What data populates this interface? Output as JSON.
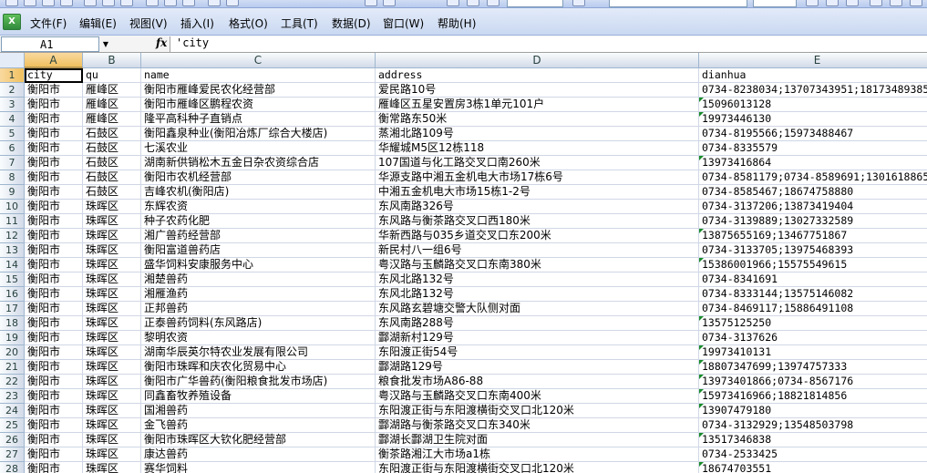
{
  "menubar": {
    "items": [
      "文件(F)",
      "编辑(E)",
      "视图(V)",
      "插入(I)",
      "格式(O)",
      "工具(T)",
      "数据(D)",
      "窗口(W)",
      "帮助(H)"
    ]
  },
  "formula_bar": {
    "name_box": "A1",
    "fx": "fx",
    "content": "'city"
  },
  "sheet": {
    "columns": [
      "A",
      "B",
      "C",
      "D",
      "E"
    ],
    "rows": [
      {
        "n": "1",
        "cells": [
          "city",
          "qu",
          "name",
          "address",
          "dianhua"
        ]
      },
      {
        "n": "2",
        "cells": [
          "衡阳市",
          "雁峰区",
          "衡阳市雁峰爱民农化经营部",
          "爱民路10号",
          "0734-8238034;13707343951;18173489385"
        ]
      },
      {
        "n": "3",
        "cells": [
          "衡阳市",
          "雁峰区",
          "衡阳市雁峰区鹏程农资",
          "雁峰区五星安置房3栋1单元101户",
          "15096013128"
        ]
      },
      {
        "n": "4",
        "cells": [
          "衡阳市",
          "雁峰区",
          "隆平高科种子直销点",
          "衡常路东50米",
          "19973446130"
        ]
      },
      {
        "n": "5",
        "cells": [
          "衡阳市",
          "石鼓区",
          "衡阳鑫泉种业(衡阳冶炼厂综合大楼店)",
          "蒸湘北路109号",
          "0734-8195566;15973488467"
        ]
      },
      {
        "n": "6",
        "cells": [
          "衡阳市",
          "石鼓区",
          "七溪农业",
          "华耀城M5区12栋118",
          "0734-8335579"
        ]
      },
      {
        "n": "7",
        "cells": [
          "衡阳市",
          "石鼓区",
          "湖南新供销松木五金日杂农资综合店",
          "107国道与化工路交叉口南260米",
          "13973416864"
        ]
      },
      {
        "n": "8",
        "cells": [
          "衡阳市",
          "石鼓区",
          "衡阳市农机经营部",
          "华源支路中湘五金机电大市场17栋6号",
          "0734-8581179;0734-8589691;13016188656"
        ]
      },
      {
        "n": "9",
        "cells": [
          "衡阳市",
          "石鼓区",
          "吉峰农机(衡阳店)",
          "中湘五金机电大市场15栋1-2号",
          "0734-8585467;18674758880"
        ]
      },
      {
        "n": "10",
        "cells": [
          "衡阳市",
          "珠晖区",
          "东辉农资",
          "东风南路326号",
          "0734-3137206;13873419404"
        ]
      },
      {
        "n": "11",
        "cells": [
          "衡阳市",
          "珠晖区",
          "种子农药化肥",
          "东风路与衡茶路交叉口西180米",
          "0734-3139889;13027332589"
        ]
      },
      {
        "n": "12",
        "cells": [
          "衡阳市",
          "珠晖区",
          "湘广兽药经营部",
          "华新西路与035乡道交叉口东200米",
          "13875655169;13467751867"
        ]
      },
      {
        "n": "13",
        "cells": [
          "衡阳市",
          "珠晖区",
          "衡阳富道兽药店",
          "新民村八一组6号",
          "0734-3133705;13975468393"
        ]
      },
      {
        "n": "14",
        "cells": [
          "衡阳市",
          "珠晖区",
          "盛华饲料安康服务中心",
          "粤汉路与玉麟路交叉口东南380米",
          "15386001966;15575549615"
        ]
      },
      {
        "n": "15",
        "cells": [
          "衡阳市",
          "珠晖区",
          "湘楚兽药",
          "东风北路132号",
          "0734-8341691"
        ]
      },
      {
        "n": "16",
        "cells": [
          "衡阳市",
          "珠晖区",
          "湘雁渔药",
          "东风北路132号",
          "0734-8333144;13575146082"
        ]
      },
      {
        "n": "17",
        "cells": [
          "衡阳市",
          "珠晖区",
          "正邦兽药",
          "东风路玄碧塘交警大队侧对面",
          "0734-8469117;15886491108"
        ]
      },
      {
        "n": "18",
        "cells": [
          "衡阳市",
          "珠晖区",
          "正泰兽药饲料(东风路店)",
          "东风南路288号",
          "13575125250"
        ]
      },
      {
        "n": "19",
        "cells": [
          "衡阳市",
          "珠晖区",
          "黎明农资",
          "酃湖新村129号",
          "0734-3137626"
        ]
      },
      {
        "n": "20",
        "cells": [
          "衡阳市",
          "珠晖区",
          "湖南华辰英尔特农业发展有限公司",
          "东阳渡正街54号",
          "19973410131"
        ]
      },
      {
        "n": "21",
        "cells": [
          "衡阳市",
          "珠晖区",
          "衡阳市珠晖和庆农化贸易中心",
          "酃湖路129号",
          "18807347699;13974757333"
        ]
      },
      {
        "n": "22",
        "cells": [
          "衡阳市",
          "珠晖区",
          "衡阳市广华兽药(衡阳粮食批发市场店)",
          "粮食批发市场A86-88",
          "13973401866;0734-8567176"
        ]
      },
      {
        "n": "23",
        "cells": [
          "衡阳市",
          "珠晖区",
          "同鑫畜牧养殖设备",
          "粤汉路与玉麟路交叉口东南400米",
          "15973416966;18821814856"
        ]
      },
      {
        "n": "24",
        "cells": [
          "衡阳市",
          "珠晖区",
          "国湘兽药",
          "东阳渡正街与东阳渡横街交叉口北120米",
          "13907479180"
        ]
      },
      {
        "n": "25",
        "cells": [
          "衡阳市",
          "珠晖区",
          "金飞兽药",
          "酃湖路与衡茶路交叉口东340米",
          "0734-3132929;13548503798"
        ]
      },
      {
        "n": "26",
        "cells": [
          "衡阳市",
          "珠晖区",
          "衡阳市珠晖区大钦化肥经营部",
          "酃湖长酃湖卫生院对面",
          "13517346838"
        ]
      },
      {
        "n": "27",
        "cells": [
          "衡阳市",
          "珠晖区",
          "康达兽药",
          "衡茶路湘江大市场a1栋",
          "0734-2533425"
        ]
      },
      {
        "n": "28",
        "cells": [
          "衡阳市",
          "珠晖区",
          "赛华饲料",
          "东阳渡正街与东阳渡横街交叉口北120米",
          "18674703551"
        ]
      }
    ],
    "text_number_rows": [
      "3",
      "4",
      "7",
      "12",
      "14",
      "18",
      "20",
      "21",
      "22",
      "23",
      "24",
      "26",
      "28"
    ]
  }
}
